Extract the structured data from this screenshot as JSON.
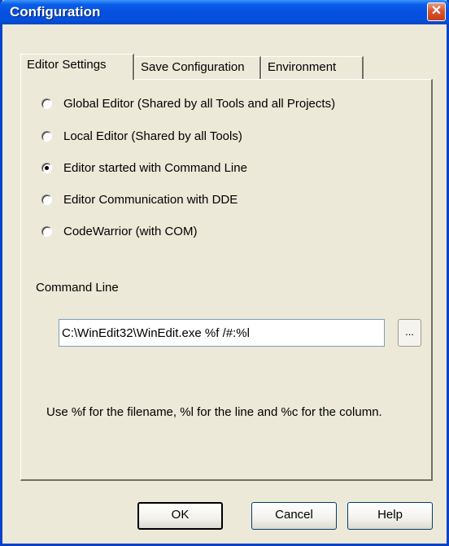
{
  "window": {
    "title": "Configuration",
    "close_label": "✕"
  },
  "tabs": [
    {
      "label": "Editor Settings",
      "active": true
    },
    {
      "label": "Save Configuration",
      "active": false
    },
    {
      "label": "Environment",
      "active": false
    }
  ],
  "editor_options": [
    {
      "label": "Global Editor (Shared by all Tools and all Projects)",
      "selected": false
    },
    {
      "label": "Local Editor (Shared by all Tools)",
      "selected": false
    },
    {
      "label": "Editor started with Command Line",
      "selected": true
    },
    {
      "label": "Editor Communication with DDE",
      "selected": false
    },
    {
      "label": "CodeWarrior (with COM)",
      "selected": false
    }
  ],
  "command_line": {
    "label": "Command Line",
    "value": "C:\\WinEdit32\\WinEdit.exe %f /#:%l",
    "browse_label": "..."
  },
  "hint_text": "Use %f for the filename, %l for the line and %c for the column.",
  "buttons": {
    "ok": "OK",
    "cancel": "Cancel",
    "help": "Help"
  }
}
